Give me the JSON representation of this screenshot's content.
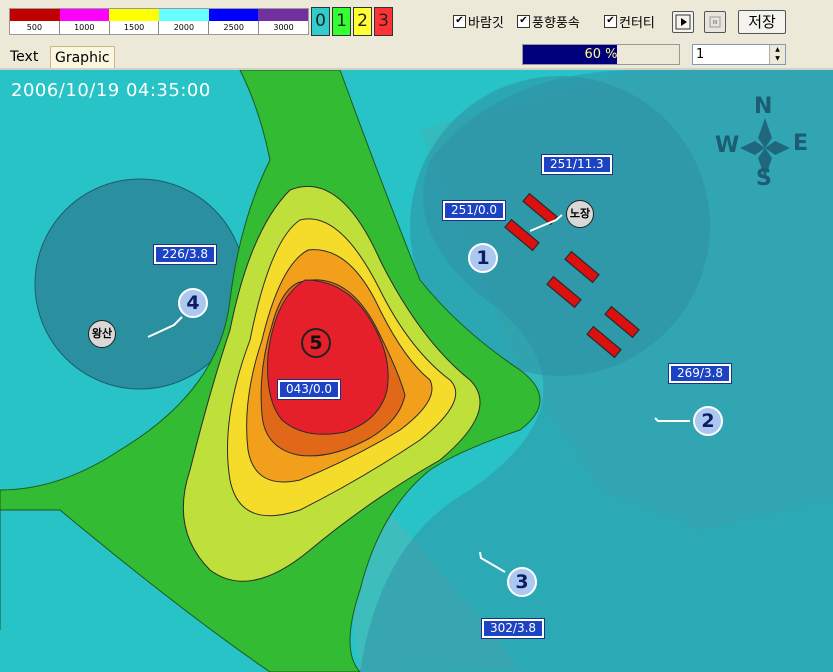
{
  "legend": {
    "colors": [
      "#c00000",
      "#ff00ff",
      "#ffff00",
      "#66ffff",
      "#0000ff",
      "#7030a0"
    ],
    "ticks": [
      "500",
      "1000",
      "1500",
      "2000",
      "2500",
      "3000"
    ]
  },
  "levels": [
    {
      "label": "0",
      "color": "#33cccc"
    },
    {
      "label": "1",
      "color": "#33ff33"
    },
    {
      "label": "2",
      "color": "#ffff33"
    },
    {
      "label": "3",
      "color": "#ff3333"
    }
  ],
  "toolbar": {
    "wind_toggle": "바람깃",
    "speed_toggle": "풍향풍속",
    "contour_toggle": "컨터티",
    "save_label": "저장"
  },
  "tabs": {
    "text": "Text",
    "graphic": "Graphic"
  },
  "progress": {
    "value": 60,
    "label": "60 %"
  },
  "spin": {
    "value": "1"
  },
  "map": {
    "datetime": "2006/10/19 04:35:00",
    "compass": {
      "n": "N",
      "s": "S",
      "e": "E",
      "w": "W"
    },
    "wind_labels": {
      "p1a": "251/11.3",
      "p1b": "251/0.0",
      "p2": "269/3.8",
      "p3": "302/3.8",
      "p4": "226/3.8",
      "p5": "043/0.0"
    },
    "stations": {
      "s1": "1",
      "s2": "2",
      "s3": "3",
      "s4": "4",
      "s5": "5"
    },
    "places": {
      "nojang": "노장",
      "wangsan": "왕산"
    }
  }
}
